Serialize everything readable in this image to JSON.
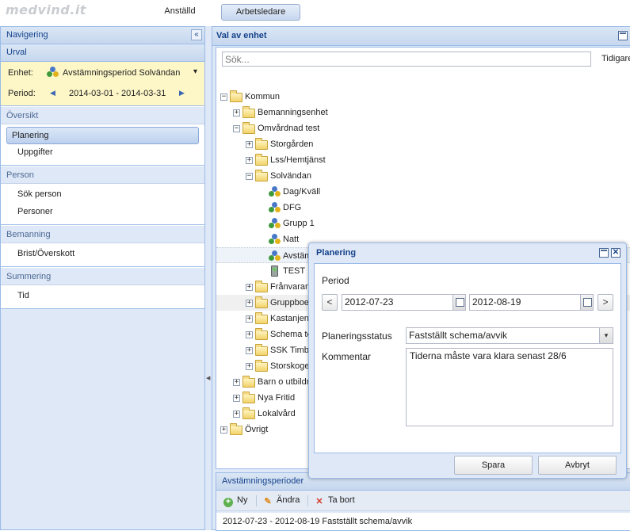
{
  "app": {
    "logo": "medvind.it"
  },
  "top_tabs": [
    "Anställd",
    "Arbetsledare"
  ],
  "left": {
    "nav_title": "Navigering",
    "collapse_glyph": "«",
    "urval_title": "Urval",
    "enhet_label": "Enhet:",
    "enhet_value": "Avstämningsperiod Solvändan",
    "enhet_arrow": "▾",
    "period_label": "Period:",
    "period_value": "2014-03-01 - 2014-03-31",
    "prev": "◀",
    "next": "▶",
    "sections": [
      {
        "title": "Översikt",
        "items": [
          "Planering",
          "Uppgifter"
        ]
      },
      {
        "title": "Person",
        "items": [
          "Sök person",
          "Personer"
        ]
      },
      {
        "title": "Bemanning",
        "items": [
          "Brist/Överskott"
        ]
      },
      {
        "title": "Summering",
        "items": [
          "Tid"
        ]
      }
    ]
  },
  "right": {
    "title": "Val av enhet",
    "search_placeholder": "Sök...",
    "tidigare": "Tidigare",
    "tree": [
      {
        "label": "Kommun",
        "toggle": "−"
      },
      {
        "label": "Bemanningsenhet",
        "toggle": "+"
      },
      {
        "label": "Omvårdnad test",
        "toggle": "−"
      },
      {
        "label": "Storgården",
        "toggle": "+"
      },
      {
        "label": "Lss/Hemtjänst",
        "toggle": "+"
      },
      {
        "label": "Solvändan",
        "toggle": "−"
      },
      {
        "label": "Dag/Kväll",
        "toggle": ""
      },
      {
        "label": "DFG",
        "toggle": ""
      },
      {
        "label": "Grupp 1",
        "toggle": ""
      },
      {
        "label": "Natt",
        "toggle": ""
      },
      {
        "label": "Avstämningsperiod Solvändan",
        "toggle": ""
      },
      {
        "label": "TEST",
        "toggle": ""
      },
      {
        "label": "Frånvarande",
        "toggle": "+"
      },
      {
        "label": "Gruppboende",
        "toggle": "+"
      },
      {
        "label": "Kastanjen",
        "toggle": "+"
      },
      {
        "label": "Schema test",
        "toggle": "+"
      },
      {
        "label": "SSK Timbanken",
        "toggle": "+"
      },
      {
        "label": "Storskogen",
        "toggle": "+"
      },
      {
        "label": "Barn o utbildning",
        "toggle": "+"
      },
      {
        "label": "Nya Fritid",
        "toggle": "+"
      },
      {
        "label": "Lokalvård",
        "toggle": "+"
      },
      {
        "label": "Övrigt",
        "toggle": "+"
      }
    ]
  },
  "bottom": {
    "title": "Avstämningsperioder",
    "tools": {
      "ny": "Ny",
      "andra": "Ändra",
      "ta_bort": "Ta bort"
    },
    "icons": {
      "ny": "+",
      "andra": "✎",
      "ta_bort": "✕"
    },
    "row": "2012-07-23 - 2012-08-19 Fastställt schema/avvik"
  },
  "dialog": {
    "title": "Planering",
    "close_glyph": "✕",
    "period_label": "Period",
    "prev": "<",
    "next": ">",
    "date_from": "2012-07-23",
    "date_to": "2012-08-19",
    "status_label": "Planeringsstatus",
    "status_value": "Fastställt schema/avvik",
    "status_arrow": "▾",
    "comment_label": "Kommentar",
    "comment_value": "Tiderna måste vara klara senast 28/6",
    "save": "Spara",
    "cancel": "Avbryt"
  },
  "colors": {
    "panel_header_text": "#15428b",
    "panel_bg": "#dfe8f6",
    "urval_bg": "#fdf7c7",
    "border": "#99bbe8"
  }
}
